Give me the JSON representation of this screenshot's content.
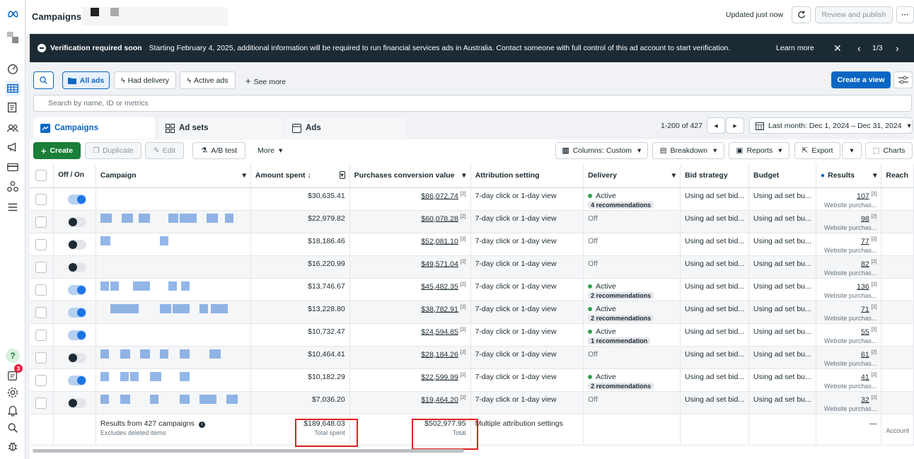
{
  "header": {
    "title": "Campaigns",
    "updated": "Updated just now",
    "review_publish": "Review and publish",
    "more": "···"
  },
  "banner": {
    "title": "Verification required soon",
    "message": "Starting February 4, 2025, additional information will be required to run financial services ads in Australia. Contact someone with full control of this ad account to start verification.",
    "learn_more": "Learn more",
    "pager": "1/3"
  },
  "filters": {
    "all_ads": "All ads",
    "had_delivery": "Had delivery",
    "active_ads": "Active ads",
    "see_more": "See more",
    "create_view": "Create a view",
    "search_placeholder": "Search by name, ID or metrics"
  },
  "tabs": {
    "campaigns": "Campaigns",
    "ad_sets": "Ad sets",
    "ads": "Ads"
  },
  "paging": {
    "range": "1-200 of 427",
    "date_range": "Last month: Dec 1, 2024 – Dec 31, 2024"
  },
  "actions": {
    "create": "Create",
    "duplicate": "Duplicate",
    "edit": "Edit",
    "ab_test": "A/B test",
    "more": "More",
    "columns": "Columns: Custom",
    "breakdown": "Breakdown",
    "reports": "Reports",
    "export": "Export",
    "charts": "Charts"
  },
  "columns": {
    "onoff": "Off / On",
    "campaign": "Campaign",
    "amount_spent": "Amount spent ↓",
    "purchases_value": "Purchases conversion value",
    "attribution": "Attribution setting",
    "delivery": "Delivery",
    "bid_strategy": "Bid strategy",
    "budget": "Budget",
    "results": "Results",
    "reach": "Reach"
  },
  "rows": [
    {
      "on": true,
      "spent": "$30,635.41",
      "value": "$86,072.74",
      "attr": "7-day click or 1-day view",
      "delivery": "Active",
      "recs": "4 recommendations",
      "bid": "Using ad set bid...",
      "budget": "Using ad set bu...",
      "results": "107",
      "results_sub": "Website purchas..."
    },
    {
      "on": false,
      "spent": "$22,979.82",
      "value": "$60,078.28",
      "attr": "7-day click or 1-day view",
      "delivery": "Off",
      "recs": "",
      "bid": "Using ad set bid...",
      "budget": "Using ad set bu...",
      "results": "98",
      "results_sub": "Website purchas..."
    },
    {
      "on": false,
      "spent": "$18,186.46",
      "value": "$52,081.10",
      "attr": "7-day click or 1-day view",
      "delivery": "Off",
      "recs": "",
      "bid": "Using ad set bid...",
      "budget": "Using ad set bu...",
      "results": "77",
      "results_sub": "Website purchas..."
    },
    {
      "on": false,
      "spent": "$16,220.99",
      "value": "$49,571.04",
      "attr": "7-day click or 1-day view",
      "delivery": "Off",
      "recs": "",
      "bid": "Using ad set bid...",
      "budget": "Using ad set bu...",
      "results": "82",
      "results_sub": "Website purchas..."
    },
    {
      "on": true,
      "spent": "$13,746.67",
      "value": "$45,482.35",
      "attr": "7-day click or 1-day view",
      "delivery": "Active",
      "recs": "2 recommendations",
      "bid": "Using ad set bid...",
      "budget": "Using ad set bu...",
      "results": "136",
      "results_sub": "Website purchas..."
    },
    {
      "on": true,
      "spent": "$13,228.80",
      "value": "$38,782.91",
      "attr": "7-day click or 1-day view",
      "delivery": "Active",
      "recs": "2 recommendations",
      "bid": "Using ad set bid...",
      "budget": "Using ad set bu...",
      "results": "71",
      "results_sub": "Website purchas..."
    },
    {
      "on": true,
      "spent": "$10,732.47",
      "value": "$24,594.85",
      "attr": "7-day click or 1-day view",
      "delivery": "Active",
      "recs": "1 recommendation",
      "bid": "Using ad set bid...",
      "budget": "Using ad set bu...",
      "results": "55",
      "results_sub": "Website purchas..."
    },
    {
      "on": false,
      "spent": "$10,464.41",
      "value": "$28,184.26",
      "attr": "7-day click or 1-day view",
      "delivery": "Off",
      "recs": "",
      "bid": "Using ad set bid...",
      "budget": "Using ad set bu...",
      "results": "61",
      "results_sub": "Website purchas..."
    },
    {
      "on": true,
      "spent": "$10,182.29",
      "value": "$22,599.99",
      "attr": "7-day click or 1-day view",
      "delivery": "Active",
      "recs": "2 recommendations",
      "bid": "Using ad set bid...",
      "budget": "Using ad set bu...",
      "results": "41",
      "results_sub": "Website purchas..."
    },
    {
      "on": false,
      "spent": "$7,036.20",
      "value": "$19,464.20",
      "attr": "7-day click or 1-day view",
      "delivery": "Off",
      "recs": "",
      "bid": "Using ad set bid...",
      "budget": "Using ad set bu...",
      "results": "32",
      "results_sub": "Website purchas..."
    }
  ],
  "superscript": "[2]",
  "footer": {
    "results_from": "Results from 427 campaigns",
    "excludes": "Excludes deleted items",
    "total_spent": "$189,648.03",
    "total_spent_label": "Total spent",
    "total_value": "$502,977.95",
    "total_value_label": "Total",
    "attribution": "Multiple attribution settings",
    "results_dash": "—",
    "reach_label": "Account"
  },
  "notifications_count": "3",
  "help": "?"
}
